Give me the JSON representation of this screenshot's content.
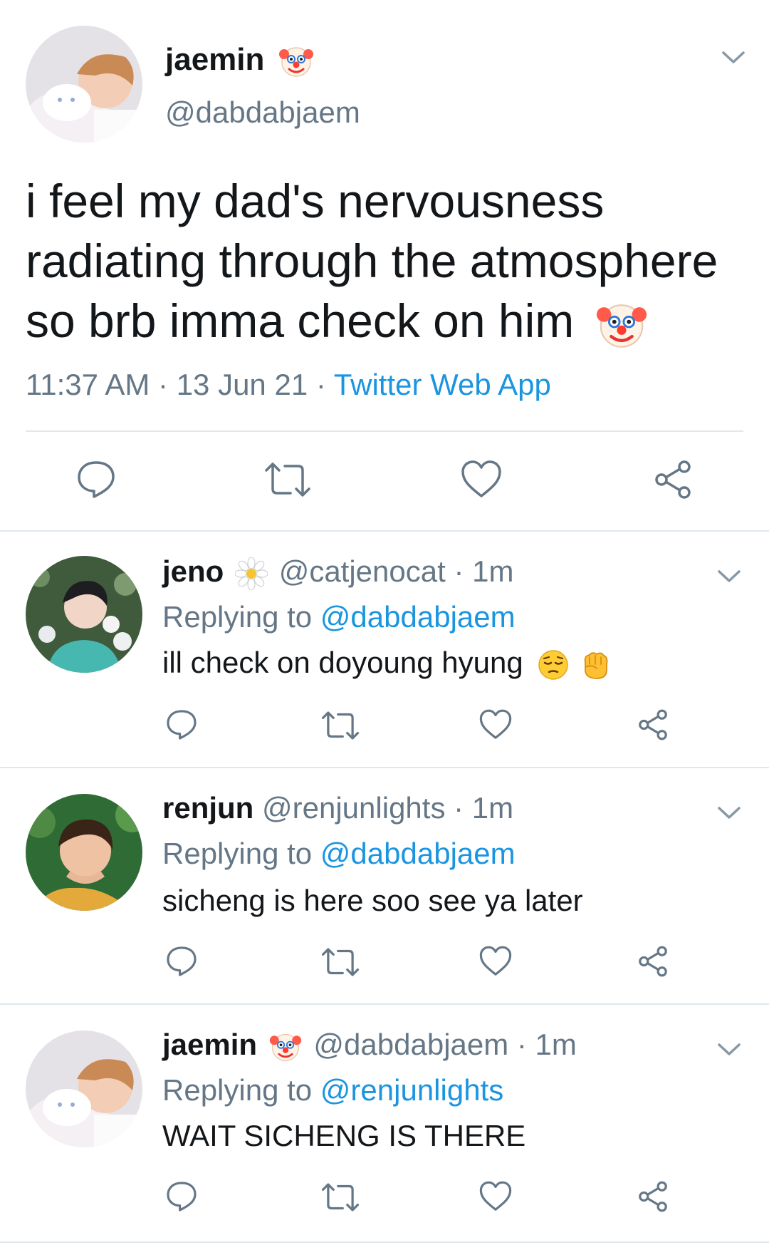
{
  "main_tweet": {
    "display_name": "jaemin",
    "name_emoji": "clown-face",
    "handle": "@dabdabjaem",
    "text_lines": [
      "i feel my dad's nervousness",
      "radiating through the atmosphere",
      "so brb imma check on him"
    ],
    "text_emoji": "clown-face",
    "time": "11:37 AM",
    "date": "13 Jun 21",
    "dot": "·",
    "source": "Twitter Web App"
  },
  "replies": [
    {
      "display_name": "jeno",
      "name_emoji": "daisy",
      "handle": "@catjenocat",
      "age": "· 1m",
      "replying_label": "Replying to",
      "replying_handle": "@dabdabjaem",
      "text": "ill check on doyoung hyung",
      "text_emojis": [
        "pensive-face",
        "raised-fist"
      ]
    },
    {
      "display_name": "renjun",
      "handle": "@renjunlights",
      "age": "· 1m",
      "replying_label": "Replying to",
      "replying_handle": "@dabdabjaem",
      "text": "sicheng is here soo see ya later"
    },
    {
      "display_name": "jaemin",
      "name_emoji": "clown-face",
      "handle": "@dabdabjaem",
      "age": "· 1m",
      "replying_label": "Replying to",
      "replying_handle": "@renjunlights",
      "text": "WAIT SICHENG IS THERE"
    }
  ],
  "action_icons": [
    "reply-icon",
    "retweet-icon",
    "like-icon",
    "share-icon"
  ],
  "colors": {
    "text": "#14171a",
    "secondary": "#657786",
    "link": "#1b95e0",
    "separator": "#e1e8ed"
  }
}
